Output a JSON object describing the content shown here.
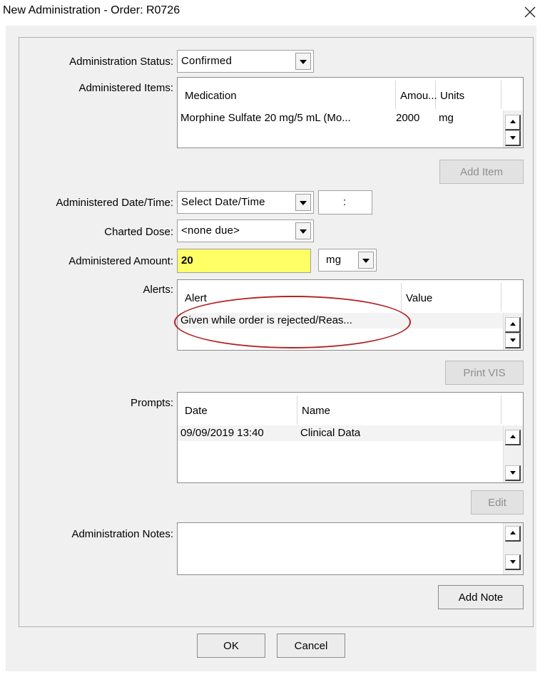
{
  "window": {
    "title": "New Administration - Order: R0726",
    "close_icon": "close-icon"
  },
  "status": {
    "label": "Administration Status:",
    "value": "Confirmed"
  },
  "items": {
    "label": "Administered Items:",
    "columns": [
      "Medication",
      "Amou...",
      "Units"
    ],
    "rows": [
      {
        "medication": "Morphine Sulfate 20 mg/5 mL (Mo...",
        "amount": "2000",
        "units": "mg"
      }
    ],
    "add_button": "Add Item"
  },
  "datetime": {
    "label": "Administered Date/Time:",
    "value": "Select Date/Time",
    "time": ":"
  },
  "charted_dose": {
    "label": "Charted Dose:",
    "value": "<none due>"
  },
  "amount": {
    "label": "Administered Amount:",
    "value": "20",
    "unit": "mg",
    "highlight_color": "#ffff66"
  },
  "alerts": {
    "label": "Alerts:",
    "columns": [
      "Alert",
      "Value"
    ],
    "rows": [
      {
        "alert": "Given while order is rejected/Reas...",
        "value": ""
      }
    ],
    "print_button": "Print VIS",
    "annotation_color": "#b22222"
  },
  "prompts": {
    "label": "Prompts:",
    "columns": [
      "Date",
      "Name"
    ],
    "rows": [
      {
        "date": "09/09/2019 13:40",
        "name": "Clinical Data"
      }
    ],
    "edit_button": "Edit"
  },
  "notes": {
    "label": "Administration Notes:",
    "add_button": "Add Note"
  },
  "footer": {
    "ok": "OK",
    "cancel": "Cancel"
  }
}
